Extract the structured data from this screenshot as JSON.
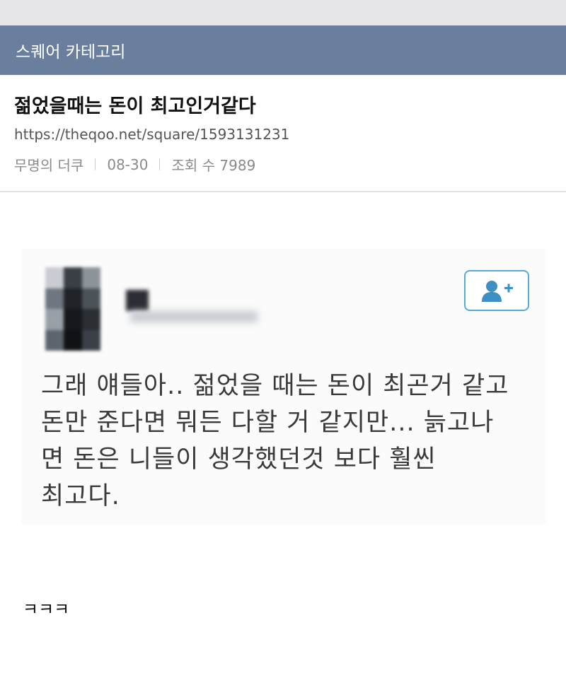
{
  "category": {
    "label": "스퀘어 카테고리"
  },
  "post": {
    "title": "젊었을때는 돈이 최고인거같다",
    "url": "https://theqoo.net/square/1593131231",
    "author": "무명의 더쿠",
    "date": "08-30",
    "views": "조회 수 7989"
  },
  "embedded_post": {
    "text": "그래 얘들아.. 젊었을 때는 돈이 최곤거 같고\n돈만 준다면 뭐든 다할 거 같지만... 늙고나\n면 돈은 니들이 생각했던것 보다 훨씬\n최고다."
  },
  "comment": {
    "text": "ㅋㅋㅋ"
  },
  "colors": {
    "category_bar": "#6a7f9e",
    "follow_button": "#58a9d6"
  }
}
